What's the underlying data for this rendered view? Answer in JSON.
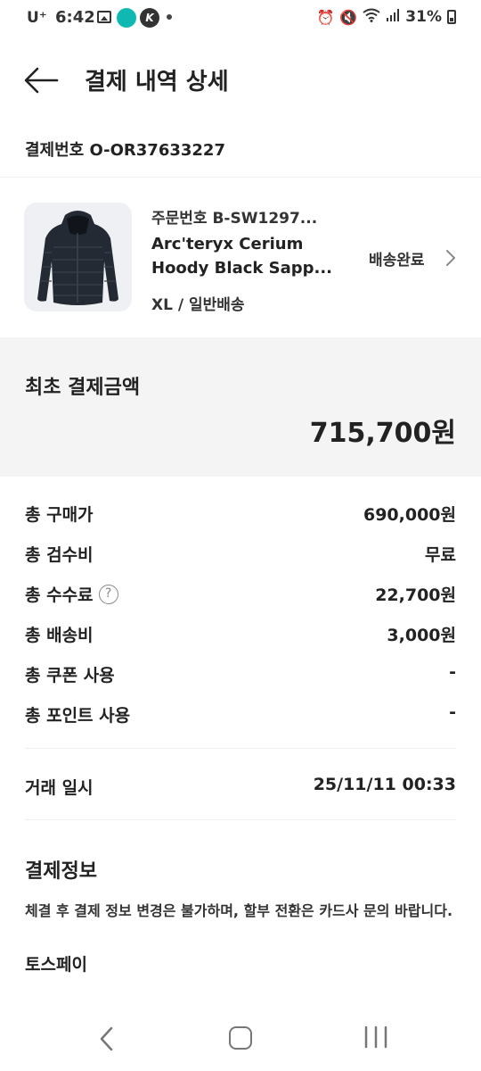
{
  "status_bar": {
    "carrier": "U⁺",
    "time": "6:42",
    "app_badge": "K",
    "battery": "31%"
  },
  "header": {
    "title": "결제 내역 상세"
  },
  "payment_number": "결제번호 O-OR37633227",
  "product": {
    "order_no": "주문번호 B-SW1297...",
    "name_line1": "Arc'teryx Cerium",
    "name_line2": "Hoody Black Sapp...",
    "option": "XL / 일반배송",
    "status": "배송완료",
    "image_icon": "puffer-jacket-image"
  },
  "first_payment": {
    "label": "최초 결제금액",
    "amount": "715,700원"
  },
  "breakdown": [
    {
      "label": "총 구매가",
      "value": "690,000원"
    },
    {
      "label": "총 검수비",
      "value": "무료"
    },
    {
      "label": "총 수수료",
      "value": "22,700원",
      "help": "?"
    },
    {
      "label": "총 배송비",
      "value": "3,000원"
    },
    {
      "label": "총 쿠폰 사용",
      "value": "-"
    },
    {
      "label": "총 포인트 사용",
      "value": "-"
    }
  ],
  "transaction": {
    "label": "거래 일시",
    "value": "25/11/11 00:33"
  },
  "payment_info": {
    "title": "결제정보",
    "desc": "체결 후 결제 정보 변경은 불가하며, 할부 전환은 카드사 문의 바랍니다.",
    "method": "토스페이"
  },
  "colors": {
    "background": "#ffffff",
    "section_bg": "#f4f4f4",
    "text": "#222222",
    "app_icon_teal": "#0fb8b0"
  }
}
